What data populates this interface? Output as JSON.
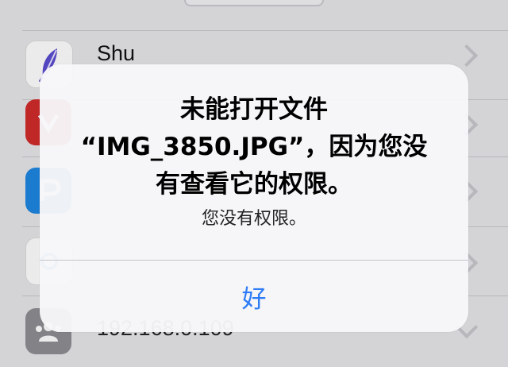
{
  "background_list": {
    "rows": [
      {
        "title": "Shu",
        "icon": "feather-icon",
        "icon_color": "#4b3fbf"
      },
      {
        "title": "",
        "icon": "app-icon-red",
        "icon_color": "#d12b2b"
      },
      {
        "title": "",
        "icon": "app-icon-blue",
        "icon_color": "#1e86e0"
      },
      {
        "title": "",
        "icon": "app-icon-white",
        "icon_color": "#ffffff"
      },
      {
        "title": "192.168.0.109",
        "icon": "users-icon",
        "icon_color": "#8e8e93"
      }
    ]
  },
  "alert": {
    "title": "未能打开文件\n“IMG_3850.JPG”，因为您没\n有查看它的权限。",
    "message": "您没有权限。",
    "button_label": "好",
    "button_color": "#2e7cf6"
  }
}
